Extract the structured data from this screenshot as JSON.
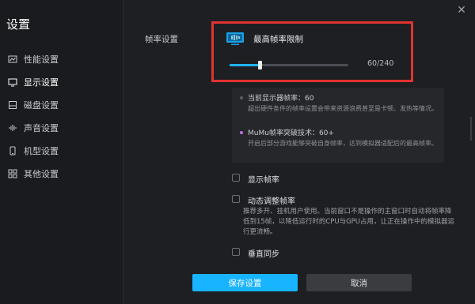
{
  "window": {
    "title": "设置",
    "close_icon": "close-icon"
  },
  "sidebar": {
    "items": [
      {
        "label": "性能设置",
        "icon": "performance-icon",
        "active": false
      },
      {
        "label": "显示设置",
        "icon": "display-icon",
        "active": true
      },
      {
        "label": "磁盘设置",
        "icon": "disk-icon",
        "active": false
      },
      {
        "label": "声音设置",
        "icon": "sound-icon",
        "active": false
      },
      {
        "label": "机型设置",
        "icon": "phone-icon",
        "active": false
      },
      {
        "label": "其他设置",
        "icon": "grid-icon",
        "active": false
      }
    ]
  },
  "main": {
    "section_label": "帧率设置",
    "fps_limit": {
      "title": "最高帧率限制",
      "value_text": "60/240",
      "value": 60,
      "max": 240
    },
    "info": {
      "item1_title": "当前显示器帧率：60",
      "item1_desc": "超出硬件条件的帧率设置会带来资源浪费甚至是卡顿、发热等情况。",
      "item2_title": "MuMu帧率突破技术：60+",
      "item2_desc": "开启后部分游戏能够突破自身帧率，达到模拟器适配后的最高帧率。"
    },
    "options": {
      "show_fps": "显示帧率",
      "dynamic_title": "动态调整帧率",
      "dynamic_desc": "推荐多开、挂机用户使用。当前窗口不是操作的主窗口时自动将帧率降低到15帧，以降低运行时的CPU与GPU占用，让正在操作中的模拟器运行更流畅。",
      "vsync_title": "垂直同步"
    },
    "buttons": {
      "save": "保存设置",
      "cancel": "取消"
    }
  },
  "colors": {
    "accent": "#18b4ff",
    "highlight_border": "#e23232",
    "dot_primary": "#5a5d63",
    "dot_purple": "#c070e0"
  }
}
